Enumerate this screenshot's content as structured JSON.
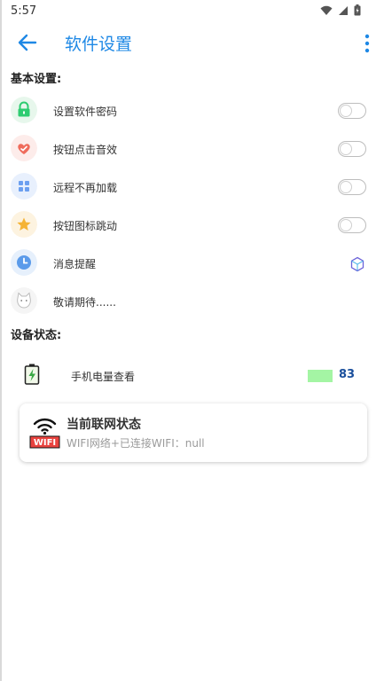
{
  "status_bar": {
    "time": "5:57"
  },
  "app_bar": {
    "title": "软件设置"
  },
  "sections": {
    "basic": "基本设置:",
    "device": "设备状态:"
  },
  "settings": [
    {
      "label": "设置软件密码",
      "icon": "lock-icon",
      "control": "toggle",
      "on": false
    },
    {
      "label": "按钮点击音效",
      "icon": "heart-icon",
      "control": "toggle",
      "on": false
    },
    {
      "label": "远程不再加载",
      "icon": "grid-icon",
      "control": "toggle",
      "on": false
    },
    {
      "label": "按钮图标跳动",
      "icon": "star-icon",
      "control": "toggle",
      "on": false
    },
    {
      "label": "消息提醒",
      "icon": "clock-icon",
      "control": "hexagon-icon"
    },
    {
      "label": "敬请期待......",
      "icon": "cat-icon",
      "control": "none"
    }
  ],
  "battery": {
    "label": "手机电量查看",
    "value": "83",
    "bar_color": "#a4f5a4"
  },
  "wifi": {
    "badge": "WIFI",
    "title": "当前联网状态",
    "detail": "WIFI网络+已连接WIFI：null"
  },
  "colors": {
    "accent": "#1e88e5",
    "battery_value": "#1a4f9c"
  }
}
